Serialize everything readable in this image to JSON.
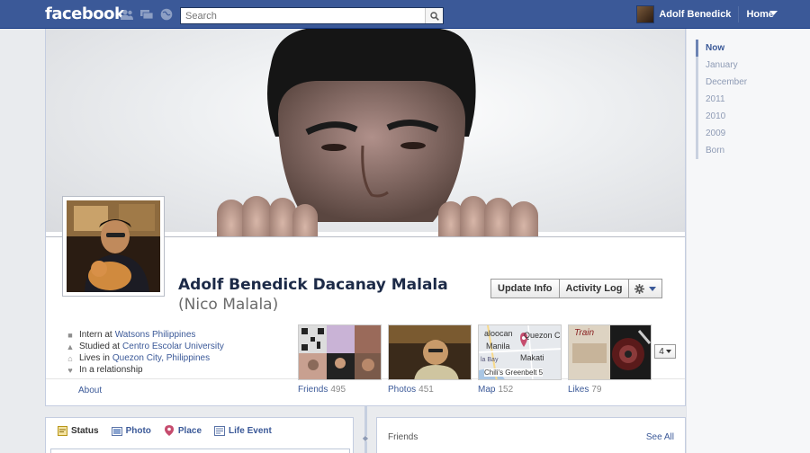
{
  "topbar": {
    "logo": "facebook",
    "search_placeholder": "Search",
    "user_name": "Adolf Benedick",
    "home": "Home",
    "jewels": [
      "friend-requests-icon",
      "messages-icon",
      "notifications-icon"
    ]
  },
  "profile": {
    "name": "Adolf Benedick Dacanay Malala",
    "nickname": "(Nico Malala)",
    "buttons": {
      "update_info": "Update Info",
      "activity_log": "Activity Log"
    }
  },
  "info": [
    {
      "prefix": "Intern at",
      "link": "Watsons Philippines",
      "icon": "briefcase-icon"
    },
    {
      "prefix": "Studied at",
      "link": "Centro Escolar University",
      "icon": "school-icon"
    },
    {
      "prefix": "Lives in",
      "link": "Quezon City, Philippines",
      "icon": "home-icon"
    },
    {
      "prefix": "In a relationship",
      "link": "",
      "icon": "heart-icon"
    }
  ],
  "about_label": "About",
  "tiles": [
    {
      "label": "Friends",
      "count": "495"
    },
    {
      "label": "Photos",
      "count": "451"
    },
    {
      "label": "Map",
      "count": "152"
    },
    {
      "label": "Likes",
      "count": "79"
    }
  ],
  "map_labels": {
    "a": "aloocan",
    "b": "Quezon C",
    "c": "Manila",
    "d": "Makati",
    "e": "la Bay",
    "f": "Chili's Greenbelt 5"
  },
  "likes_label": "Train",
  "more_count": "4",
  "timeline": [
    "Now",
    "January",
    "December",
    "2011",
    "2010",
    "2009",
    "Born"
  ],
  "composer": {
    "status": "Status",
    "photo": "Photo",
    "place": "Place",
    "life_event": "Life Event"
  },
  "friends_card": {
    "title": "Friends",
    "see_all": "See All"
  },
  "colors": {
    "brand": "#3b5998",
    "link": "#3b5998"
  }
}
